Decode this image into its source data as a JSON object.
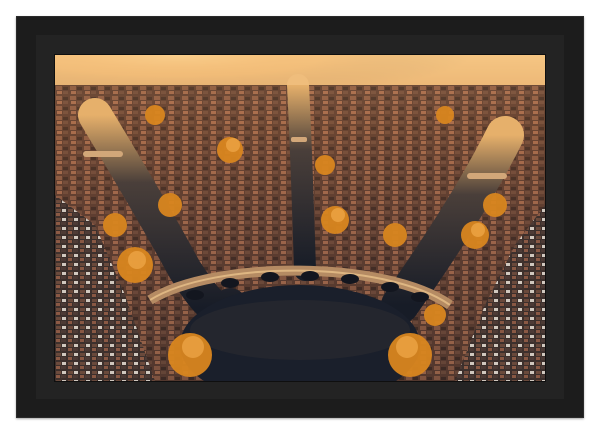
{
  "artwork": {
    "subject": "aerial-canal-city-autumn-sunset",
    "colors": {
      "frame": "#1c1c1c",
      "mat": "#232323",
      "water": "#1d2330",
      "sky_glow": "#f2b061",
      "foliage": "#d9861f",
      "roofs": "#6b3a2c"
    }
  }
}
